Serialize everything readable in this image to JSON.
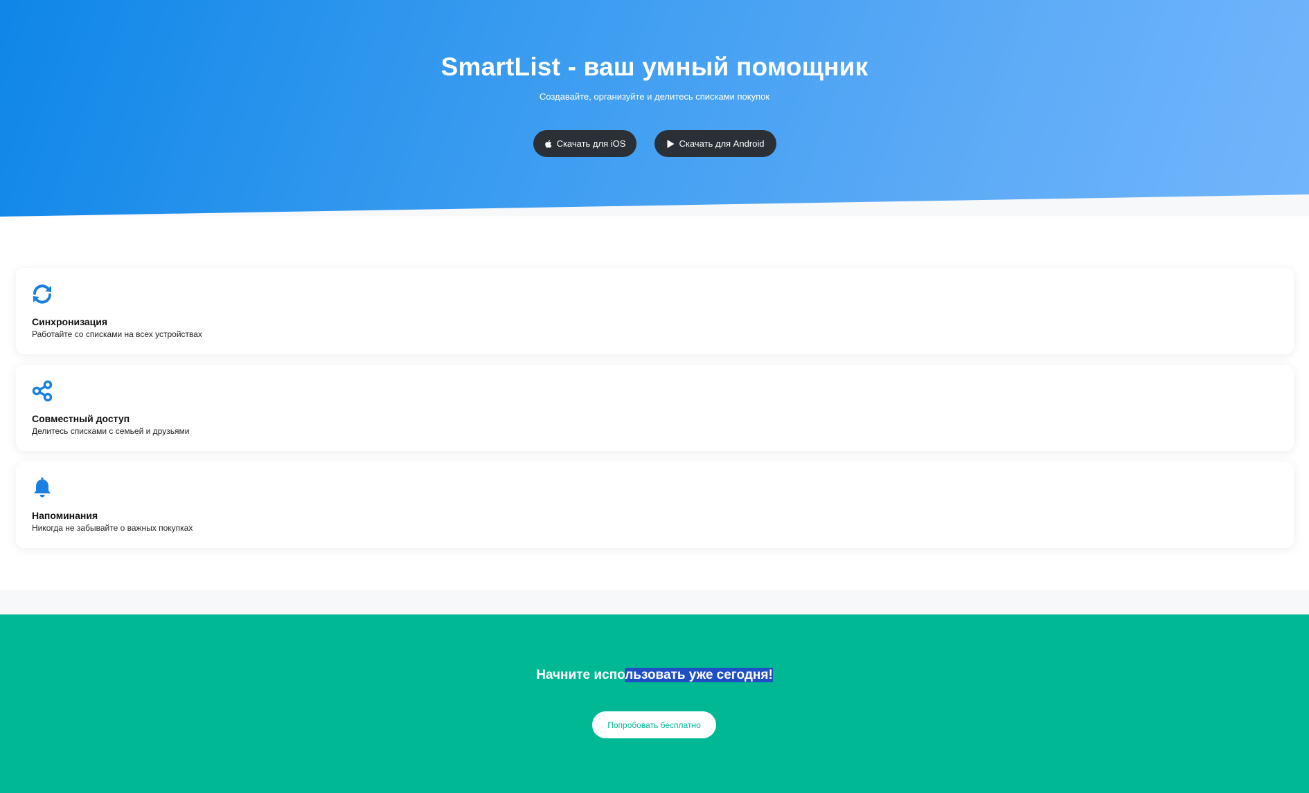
{
  "hero": {
    "title": "SmartList - ваш умный помощник",
    "subtitle": "Создавайте, организуйте и делитесь списками покупок",
    "ios_label": "Скачать для iOS",
    "android_label": "Скачать для Android",
    "ios_icon": "apple-icon",
    "android_icon": "play-icon"
  },
  "features": [
    {
      "icon": "sync-icon",
      "title": "Синхронизация",
      "desc": "Работайте со списками на всех устройствах"
    },
    {
      "icon": "share-icon",
      "title": "Совместный доступ",
      "desc": "Делитесь списками с семьей и друзьями"
    },
    {
      "icon": "bell-icon",
      "title": "Напоминания",
      "desc": "Никогда не забывайте о важных покупках"
    }
  ],
  "cta": {
    "title_part1": "Начните испо",
    "title_part2": "льзовать уже сегодня!",
    "button_label": "Попробовать бесплатно"
  },
  "colors": {
    "hero_start": "#0f86e8",
    "hero_end": "#72b6fc",
    "icon_blue": "#1a7fe0",
    "cta_green": "#00b894",
    "store_button": "#2a3035",
    "selection": "#1e4fc4"
  }
}
